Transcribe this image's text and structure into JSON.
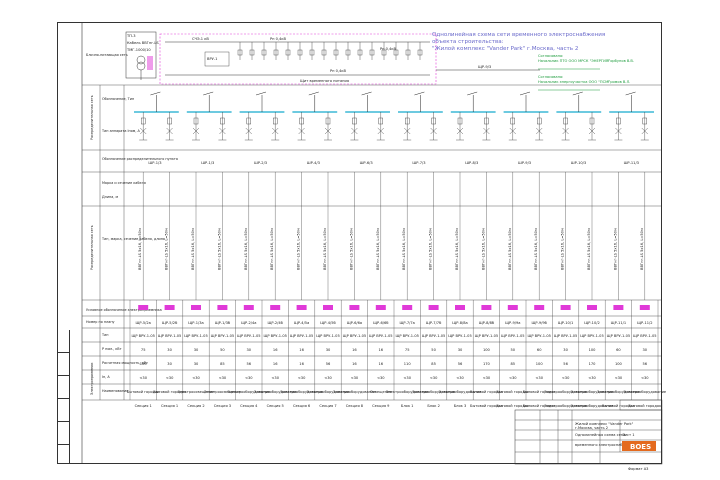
{
  "title": {
    "line1": "Однолинейная схема сети временного электроснабжения",
    "line2": "объекта строительства:",
    "line3": "\"Жилой комплекс \"Vander Park\" г.Москва, часть 2"
  },
  "approvals": {
    "a1_label": "Согласовано:",
    "a1_role": "Начальник ПТО ООО МРСК \"ЭНЕРГИЯ\"",
    "a1_name": "Горбунов В.В.",
    "a2_label": "Согласовано:",
    "a2_role": "Начальник энергоучастка ООО \"ПСМ\"",
    "a2_name": "Громов В.Л."
  },
  "network": {
    "label": "Блочно-питающая сеть",
    "tp": "ТП-3",
    "cable": "Кабель ВВГнг-LS",
    "trans_left": "ТМГ-1000/10",
    "trans_right": "ТМГ-1000/10",
    "bus_a": "СЧЭ-1 кВ",
    "bus_b": "ВРУ-1",
    "bus_label": "Щит временного питания",
    "feeder_r1": "Рн 0,4кВ",
    "feeder_r2": "Рн 0,4кВ",
    "feeder_r3": "Рн 0,4кВ",
    "right_panel": "ЩР-9/3"
  },
  "row_labels": {
    "r1": "Распределительная сеть",
    "r1a": "Обозначение, Тип",
    "r1b": "Тип аппарата Iном, А",
    "r2": "Обозначение распределительного пункта",
    "r3a": "Марка и сечение кабеля",
    "r3b": "Длина, м",
    "r4": "Распределительная сеть",
    "r4a": "Тип, марка, сечение кабеля, длина",
    "r5": "Условное обозначение электроприемника",
    "r6": "Номер по плану",
    "r7a": "Тип",
    "r7b": "Р ном., кВт",
    "r7c": "Расчетная мощность, кВт",
    "r7d": "Iн, А",
    "r8": "Наименование",
    "r9": "Электроприемник"
  },
  "panels": [
    {
      "id": "ЩР-5/2а",
      "type": "ЩР ВРУ-1-05",
      "p": "75",
      "pr": "100",
      "i": "<30",
      "name": "Бытовой городок",
      "loc": "Секция 1"
    },
    {
      "id": "ЩР-5/2б",
      "type": "ЩР ВРУ-1-05",
      "p": "30",
      "pr": "30",
      "i": "<30",
      "name": "Бытовой городок",
      "loc": "Секция 1"
    },
    {
      "id": "ЩР-1/3а",
      "type": "ЩР ВРУ-1-05",
      "p": "30",
      "pr": "30",
      "i": "<30",
      "name": "Электроосвещение",
      "loc": "Секция 2"
    },
    {
      "id": "ЩР-1/3б",
      "type": "ЩР ВРУ-1-05",
      "p": "50",
      "pr": "85",
      "i": "<30",
      "name": "Электроосвещение",
      "loc": "Секция 3"
    },
    {
      "id": "ЩР-2/4а",
      "type": "ЩР ВРУ-1-05",
      "p": "30",
      "pr": "56",
      "i": "<30",
      "name": "Электрооборудование",
      "loc": "Секция 4"
    },
    {
      "id": "ЩР-2/4б",
      "type": "ЩР ВРУ-1-05",
      "p": "16",
      "pr": "16",
      "i": "<30",
      "name": "Электрооборудование",
      "loc": "Секция 5"
    },
    {
      "id": "ЩР-4/5а",
      "type": "ЩР ВРУ-1-05",
      "p": "16",
      "pr": "16",
      "i": "<30",
      "name": "Электрооборудование",
      "loc": "Секция 6"
    },
    {
      "id": "ЩР-4/5б",
      "type": "ЩР ВРУ-1-05",
      "p": "30",
      "pr": "56",
      "i": "<30",
      "name": "Электрооборудование",
      "loc": "Секция 7"
    },
    {
      "id": "ЩР-6/6а",
      "type": "ЩР ВРУ-1-05",
      "p": "16",
      "pr": "16",
      "i": "<30",
      "name": "Электрооборудование",
      "loc": "Секция 8"
    },
    {
      "id": "ЩР-6/6б",
      "type": "ЩР ВРУ-1-05",
      "p": "16",
      "pr": "16",
      "i": "<30",
      "name": "Освещение",
      "loc": "Секция 9"
    },
    {
      "id": "ЩР-7/7а",
      "type": "ЩР ВРУ-1-05",
      "p": "75",
      "pr": "110",
      "i": "<30",
      "name": "Электрооборудование",
      "loc": "Блок 1"
    },
    {
      "id": "ЩР-7/7б",
      "type": "ЩР ВРУ-1-05",
      "p": "50",
      "pr": "85",
      "i": "<30",
      "name": "Электрооборудование",
      "loc": "Блок 2"
    },
    {
      "id": "ЩР-8/8а",
      "type": "ЩР ВРУ-1-05",
      "p": "30",
      "pr": "56",
      "i": "<30",
      "name": "Электрооборудование",
      "loc": "Блок 3"
    },
    {
      "id": "ЩР-8/8б",
      "type": "ЩР ВРУ-1-05",
      "p": "100",
      "pr": "170",
      "i": "<30",
      "name": "Бытовой городок",
      "loc": "Бытовой городок"
    },
    {
      "id": "ЩР-9/9а",
      "type": "ЩР ВРУ-1-05",
      "p": "50",
      "pr": "85",
      "i": "<30",
      "name": "Бытовой городок",
      "loc": "Бытовой городок"
    },
    {
      "id": "ЩР-9/9б",
      "type": "ЩР ВРУ-1-05",
      "p": "60",
      "pr": "100",
      "i": "<30",
      "name": "Бытовой городок",
      "loc": "Бытовой городок"
    },
    {
      "id": "ЩР-10/1",
      "type": "ЩР ВРУ-1-05",
      "p": "30",
      "pr": "56",
      "i": "<30",
      "name": "Электрооборудование",
      "loc": "Электрооборудование"
    },
    {
      "id": "ЩР-10/2",
      "type": "ЩР ВРУ-1-05",
      "p": "100",
      "pr": "170",
      "i": "<30",
      "name": "Электрооборудование",
      "loc": "Электрооборудование"
    },
    {
      "id": "ЩР-11/1",
      "type": "ЩР ВРУ-1-05",
      "p": "60",
      "pr": "100",
      "i": "<30",
      "name": "Электрооборудование",
      "loc": "Бытовой городок"
    },
    {
      "id": "ЩР-11/2",
      "type": "ЩР ВРУ-1-05",
      "p": "30",
      "pr": "56",
      "i": "<30",
      "name": "Электрооборудование",
      "loc": "Бытовой городок"
    }
  ],
  "mid_labels": [
    "ШР-1/3",
    "ШР-1/3",
    "ШР-2/3",
    "ШР-4/3",
    "ШР-6/3",
    "ШР-7/3",
    "ШР-8/3",
    "ШР-9/3",
    "ШР-10/3",
    "ШР-11/3"
  ],
  "cable_label": "ВВГнг-LS 5х16, L=50м",
  "titleblock": {
    "company": "BOES",
    "desc1": "Жилой комплекс \"Vander Park\"",
    "desc2": "г.Москва, часть 2",
    "desc3": "Однолинейная схема сети",
    "desc4": "временного электроснабжения",
    "sheet": "Лист 1",
    "format": "Формат А3"
  },
  "colors": {
    "line": "#222222",
    "cyan_bus": "#3db8d6",
    "magenta": "#e03ad8",
    "green": "#1a9a3a",
    "title_blue": "#6a6acb",
    "logo_bg": "#e46a1e"
  }
}
